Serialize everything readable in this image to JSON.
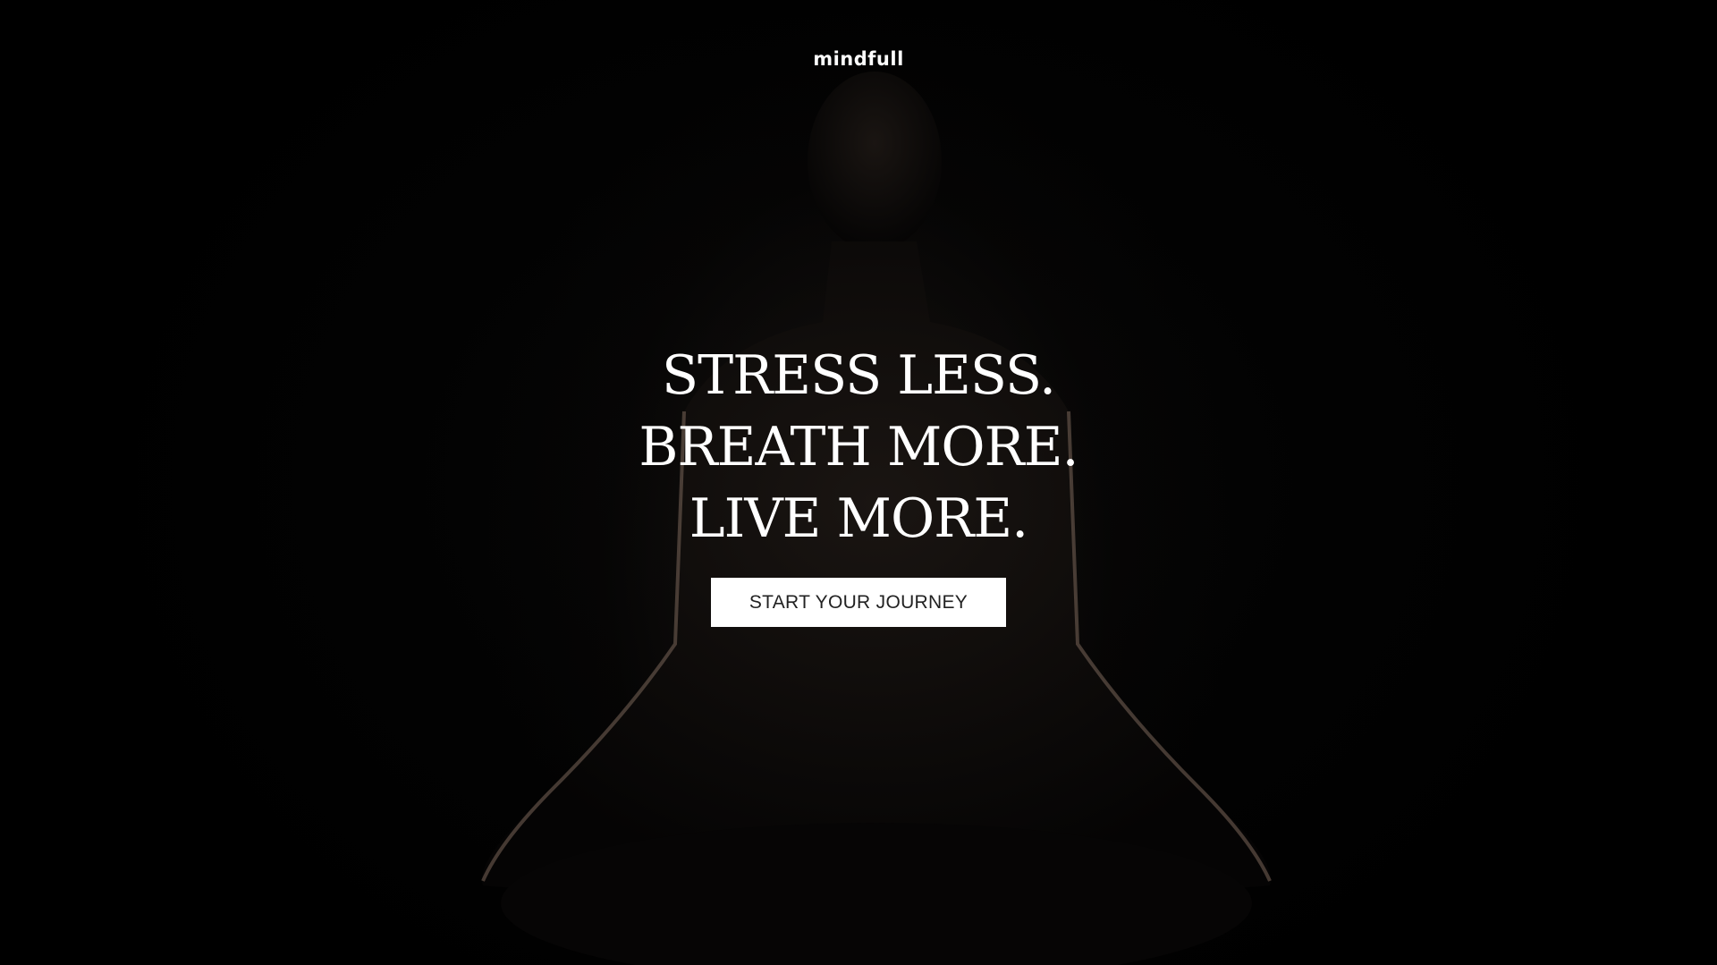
{
  "header": {
    "brand": "mindfull"
  },
  "hero": {
    "headline_lines": [
      "STRESS LESS.",
      "BREATH MORE.",
      "LIVE MORE."
    ],
    "cta_label": "START YOUR JOURNEY"
  },
  "colors": {
    "background": "#000000",
    "text": "#ffffff",
    "button_bg": "#ffffff",
    "button_text": "#222222"
  }
}
